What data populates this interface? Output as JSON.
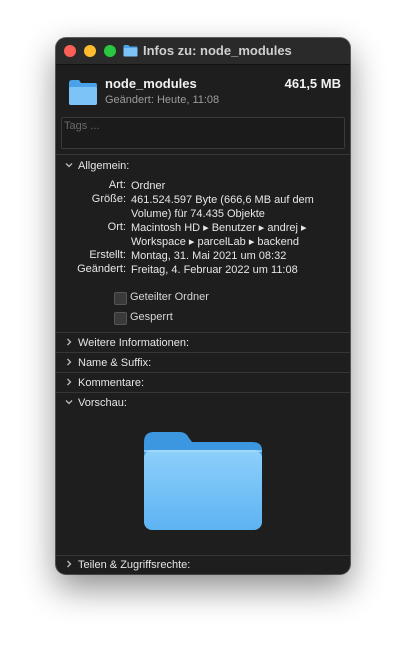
{
  "window": {
    "title": "Infos zu: node_modules"
  },
  "header": {
    "name": "node_modules",
    "size": "461,5 MB",
    "modified": "Geändert: Heute, 11:08"
  },
  "tags": {
    "placeholder": "Tags ..."
  },
  "general": {
    "label": "Allgemein:",
    "rows": [
      {
        "key": "Art:",
        "value": "Ordner"
      },
      {
        "key": "Größe:",
        "value_lines": [
          "461.524.597 Byte (666,6 MB auf dem",
          "Volume) für 74.435 Objekte"
        ]
      },
      {
        "key": "Ort:",
        "value_lines": [
          "Macintosh HD ▸ Benutzer ▸ andrej ▸",
          "Workspace ▸ parcelLab ▸ backend"
        ]
      },
      {
        "key": "Erstellt:",
        "value": "Montag, 31. Mai 2021 um 08:32"
      },
      {
        "key": "Geändert:",
        "value": "Freitag, 4. Februar 2022 um 11:08"
      }
    ],
    "checkboxes": [
      {
        "label": "Geteilter Ordner",
        "checked": false
      },
      {
        "label": "Gesperrt",
        "checked": false
      }
    ]
  },
  "sections": {
    "more_info": "Weitere Informationen:",
    "name_ext": "Name & Suffix:",
    "comments": "Kommentare:",
    "preview": "Vorschau:",
    "sharing": "Teilen & Zugriffsrechte:"
  },
  "colors": {
    "folder_light": "#7cc4f8",
    "folder_dark": "#4aa3ea",
    "background": "#1e1e1e"
  },
  "icons": {
    "folder": "folder-icon",
    "chevron_open": "chevron-down-icon",
    "chevron_closed": "chevron-right-icon"
  }
}
